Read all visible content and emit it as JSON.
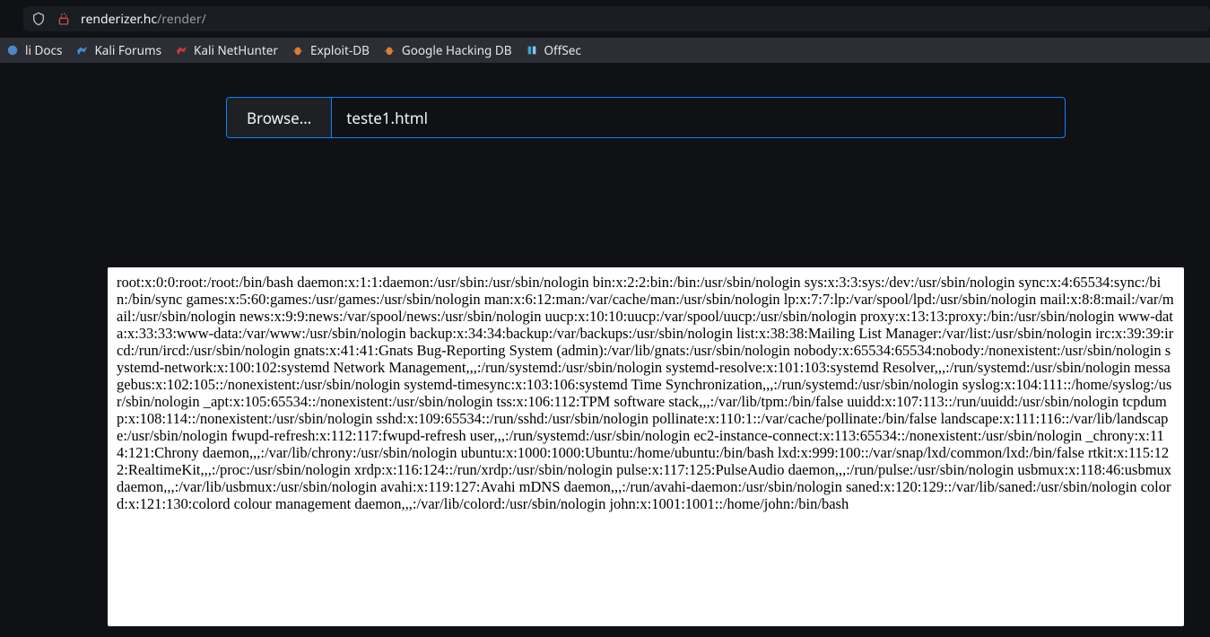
{
  "url": {
    "host": "renderizer.hc",
    "path": "/render/"
  },
  "bookmarks": [
    {
      "label": "li Docs",
      "icon_color": "#4a88c7"
    },
    {
      "label": "Kali Forums",
      "icon_color": "#3f8fd3"
    },
    {
      "label": "Kali NetHunter",
      "icon_color": "#c73a3a"
    },
    {
      "label": "Exploit-DB",
      "icon_color": "#e07c2e"
    },
    {
      "label": "Google Hacking DB",
      "icon_color": "#e07c2e"
    },
    {
      "label": "OffSec",
      "icon_color": "#3aa6d6"
    }
  ],
  "upload": {
    "browse_label": "Browse…",
    "file_name": "teste1.html"
  },
  "output_text": "root:x:0:0:root:/root:/bin/bash daemon:x:1:1:daemon:/usr/sbin:/usr/sbin/nologin bin:x:2:2:bin:/bin:/usr/sbin/nologin sys:x:3:3:sys:/dev:/usr/sbin/nologin sync:x:4:65534:sync:/bin:/bin/sync games:x:5:60:games:/usr/games:/usr/sbin/nologin man:x:6:12:man:/var/cache/man:/usr/sbin/nologin lp:x:7:7:lp:/var/spool/lpd:/usr/sbin/nologin mail:x:8:8:mail:/var/mail:/usr/sbin/nologin news:x:9:9:news:/var/spool/news:/usr/sbin/nologin uucp:x:10:10:uucp:/var/spool/uucp:/usr/sbin/nologin proxy:x:13:13:proxy:/bin:/usr/sbin/nologin www-data:x:33:33:www-data:/var/www:/usr/sbin/nologin backup:x:34:34:backup:/var/backups:/usr/sbin/nologin list:x:38:38:Mailing List Manager:/var/list:/usr/sbin/nologin irc:x:39:39:ircd:/run/ircd:/usr/sbin/nologin gnats:x:41:41:Gnats Bug-Reporting System (admin):/var/lib/gnats:/usr/sbin/nologin nobody:x:65534:65534:nobody:/nonexistent:/usr/sbin/nologin systemd-network:x:100:102:systemd Network Management,,,:/run/systemd:/usr/sbin/nologin systemd-resolve:x:101:103:systemd Resolver,,,:/run/systemd:/usr/sbin/nologin messagebus:x:102:105::/nonexistent:/usr/sbin/nologin systemd-timesync:x:103:106:systemd Time Synchronization,,,:/run/systemd:/usr/sbin/nologin syslog:x:104:111::/home/syslog:/usr/sbin/nologin _apt:x:105:65534::/nonexistent:/usr/sbin/nologin tss:x:106:112:TPM software stack,,,:/var/lib/tpm:/bin/false uuidd:x:107:113::/run/uuidd:/usr/sbin/nologin tcpdump:x:108:114::/nonexistent:/usr/sbin/nologin sshd:x:109:65534::/run/sshd:/usr/sbin/nologin pollinate:x:110:1::/var/cache/pollinate:/bin/false landscape:x:111:116::/var/lib/landscape:/usr/sbin/nologin fwupd-refresh:x:112:117:fwupd-refresh user,,,:/run/systemd:/usr/sbin/nologin ec2-instance-connect:x:113:65534::/nonexistent:/usr/sbin/nologin _chrony:x:114:121:Chrony daemon,,,:/var/lib/chrony:/usr/sbin/nologin ubuntu:x:1000:1000:Ubuntu:/home/ubuntu:/bin/bash lxd:x:999:100::/var/snap/lxd/common/lxd:/bin/false rtkit:x:115:122:RealtimeKit,,,:/proc:/usr/sbin/nologin xrdp:x:116:124::/run/xrdp:/usr/sbin/nologin pulse:x:117:125:PulseAudio daemon,,,:/run/pulse:/usr/sbin/nologin usbmux:x:118:46:usbmux daemon,,,:/var/lib/usbmux:/usr/sbin/nologin avahi:x:119:127:Avahi mDNS daemon,,,:/run/avahi-daemon:/usr/sbin/nologin saned:x:120:129::/var/lib/saned:/usr/sbin/nologin colord:x:121:130:colord colour management daemon,,,:/var/lib/colord:/usr/sbin/nologin john:x:1001:1001::/home/john:/bin/bash"
}
